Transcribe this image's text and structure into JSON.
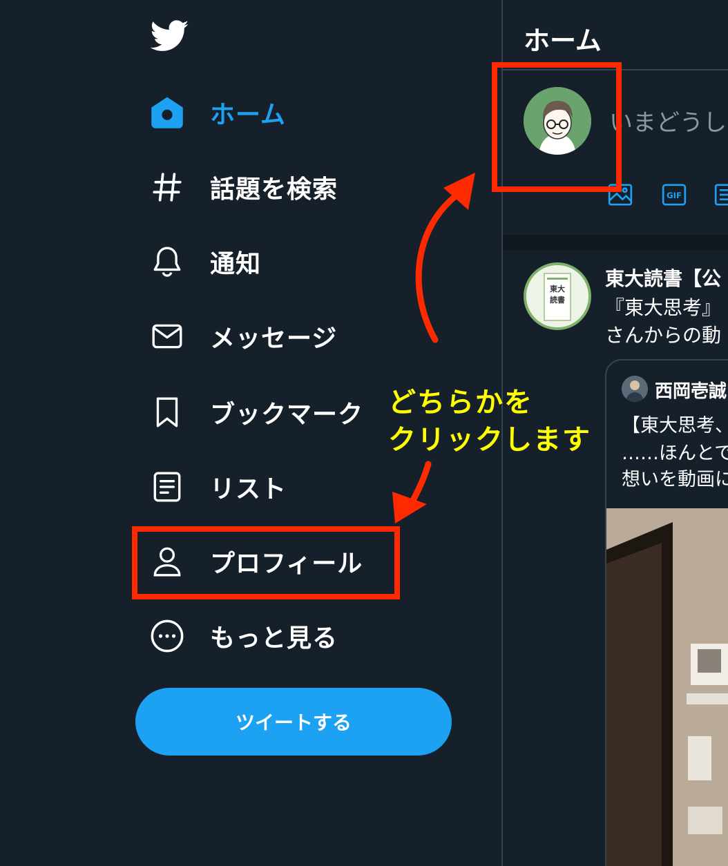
{
  "sidebar": {
    "items": [
      {
        "label": "ホーム",
        "icon": "home-icon",
        "active": true
      },
      {
        "label": "話題を検索",
        "icon": "hashtag-icon"
      },
      {
        "label": "通知",
        "icon": "bell-icon"
      },
      {
        "label": "メッセージ",
        "icon": "envelope-icon"
      },
      {
        "label": "ブックマーク",
        "icon": "bookmark-icon"
      },
      {
        "label": "リスト",
        "icon": "list-icon"
      },
      {
        "label": "プロフィール",
        "icon": "person-icon"
      },
      {
        "label": "もっと見る",
        "icon": "more-circle-icon"
      }
    ],
    "tweet_button": "ツイートする"
  },
  "main": {
    "title": "ホーム",
    "composer": {
      "placeholder": "いまどうし"
    },
    "tweet": {
      "author": "東大読書【公",
      "lines": [
        "『東大思考』",
        "さんからの動"
      ],
      "quote": {
        "author": "西岡壱誠",
        "lines": [
          "【東大思考、",
          "……ほんとで",
          "想いを動画に"
        ]
      }
    }
  },
  "annotation": {
    "lines": [
      "どちらかを",
      "クリックします"
    ]
  },
  "colors": {
    "background": "#15202b",
    "accent": "#1da1f2",
    "annotation_red": "#ff2a00",
    "annotation_yellow": "#ffff00"
  }
}
